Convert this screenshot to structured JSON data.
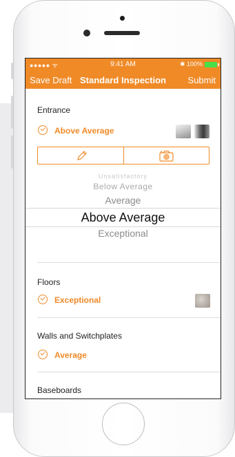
{
  "status_bar": {
    "signal": "●●●●● ᯤ",
    "time": "9:41 AM",
    "battery": "✱ 100%"
  },
  "nav": {
    "left": "Save Draft",
    "title": "Standard Inspection",
    "right": "Submit"
  },
  "sections": [
    {
      "title": "Entrance",
      "rating": "Above Average"
    },
    {
      "title": "Floors",
      "rating": "Exceptional"
    },
    {
      "title": "Walls and Switchplates",
      "rating": "Average"
    },
    {
      "title": "Baseboards"
    }
  ],
  "picker": {
    "options": [
      "Unsatisfactory",
      "Below Average",
      "Average",
      "Above Average",
      "Exceptional"
    ],
    "selected": "Above Average"
  },
  "icons": {
    "edit": "pencil-icon",
    "camera": "camera-icon",
    "check": "check-circle-icon"
  },
  "colors": {
    "accent": "#f08a27",
    "battery": "#47e049"
  }
}
